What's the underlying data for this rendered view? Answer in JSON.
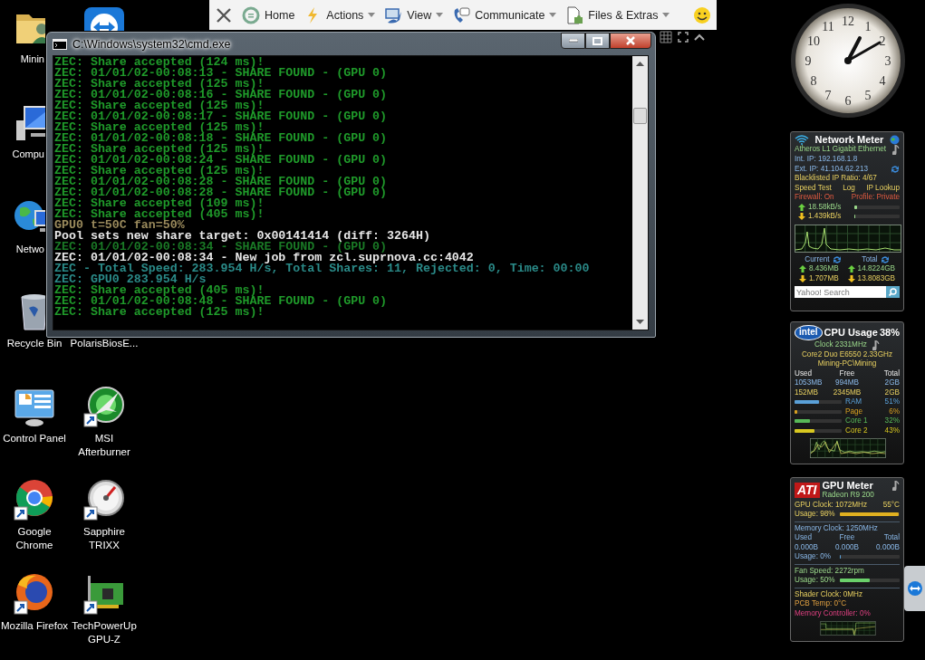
{
  "remote_toolbar": {
    "items": [
      {
        "label": "Home",
        "kind": "home",
        "dropdown": false
      },
      {
        "label": "Actions",
        "kind": "actions",
        "dropdown": true
      },
      {
        "label": "View",
        "kind": "view",
        "dropdown": true
      },
      {
        "label": "Communicate",
        "kind": "communicate",
        "dropdown": true
      },
      {
        "label": "Files & Extras",
        "kind": "files",
        "dropdown": true
      }
    ]
  },
  "desktop_icons": [
    {
      "label": "Minin",
      "kind": "folder",
      "shortcut": false
    },
    {
      "kind": "teamviewer"
    },
    {
      "label": "Compu",
      "kind": "computer",
      "shortcut": false
    },
    {
      "label": "Netwo",
      "kind": "network",
      "shortcut": false
    },
    {
      "label": "Recycle Bin",
      "kind": "recycle",
      "shortcut": false
    },
    {
      "label": "PolarisBiosE...",
      "kind": "hidden"
    },
    {
      "label": "Control Panel",
      "kind": "control-panel",
      "shortcut": false
    },
    {
      "label": "MSI Afterburner",
      "kind": "afterburner",
      "shortcut": true
    },
    {
      "label": "Google Chrome",
      "kind": "chrome",
      "shortcut": true
    },
    {
      "label": "Sapphire TRIXX",
      "kind": "gauge",
      "shortcut": true
    },
    {
      "label": "Mozilla Firefox",
      "kind": "firefox",
      "shortcut": true
    },
    {
      "label": "TechPowerUp GPU-Z",
      "kind": "card",
      "shortcut": true
    }
  ],
  "console_window": {
    "title": "C:\\Windows\\system32\\cmd.exe",
    "lines": [
      {
        "text": "ZEC: Share accepted (124 ms)!",
        "color": "#1f9a2a"
      },
      {
        "text": "ZEC: 01/01/02-00:08:13 - SHARE FOUND - (GPU 0)",
        "color": "#1f9a2a"
      },
      {
        "text": "ZEC: Share accepted (125 ms)!",
        "color": "#1f9a2a"
      },
      {
        "text": "ZEC: 01/01/02-00:08:16 - SHARE FOUND - (GPU 0)",
        "color": "#1f9a2a"
      },
      {
        "text": "ZEC: Share accepted (125 ms)!",
        "color": "#1f9a2a"
      },
      {
        "text": "ZEC: 01/01/02-00:08:17 - SHARE FOUND - (GPU 0)",
        "color": "#1f9a2a"
      },
      {
        "text": "ZEC: Share accepted (125 ms)!",
        "color": "#1f9a2a"
      },
      {
        "text": "ZEC: 01/01/02-00:08:18 - SHARE FOUND - (GPU 0)",
        "color": "#1f9a2a"
      },
      {
        "text": "ZEC: Share accepted (125 ms)!",
        "color": "#1f9a2a"
      },
      {
        "text": "ZEC: 01/01/02-00:08:24 - SHARE FOUND - (GPU 0)",
        "color": "#1f9a2a"
      },
      {
        "text": "ZEC: Share accepted (125 ms)!",
        "color": "#1f9a2a"
      },
      {
        "text": "ZEC: 01/01/02-00:08:28 - SHARE FOUND - (GPU 0)",
        "color": "#1f9a2a"
      },
      {
        "text": "ZEC: 01/01/02-00:08:28 - SHARE FOUND - (GPU 0)",
        "color": "#1f9a2a"
      },
      {
        "text": "ZEC: Share accepted (109 ms)!",
        "color": "#1f9a2a"
      },
      {
        "text": "ZEC: Share accepted (405 ms)!",
        "color": "#1f9a2a"
      },
      {
        "text": "GPU0 t=50C fan=50%",
        "color": "#9a8a5c"
      },
      {
        "text": "Pool sets new share target: 0x00141414 (diff: 3264H)",
        "color": "#e8e8e8"
      },
      {
        "text": "ZEC: 01/01/02-00:08:34 - SHARE FOUND - (GPU 0)",
        "color": "#1a7a26"
      },
      {
        "text": "ZEC: 01/01/02-00:08:34 - New job from zcl.suprnova.cc:4042",
        "color": "#e8e8e8"
      },
      {
        "text": "ZEC - Total Speed: 283.954 H/s, Total Shares: 11, Rejected: 0, Time: 00:00",
        "color": "#2a8a88"
      },
      {
        "text": "ZEC: GPU0 283.954 H/s",
        "color": "#2a8a88"
      },
      {
        "text": "ZEC: Share accepted (405 ms)!",
        "color": "#1f9a2a"
      },
      {
        "text": "ZEC: 01/01/02-00:08:48 - SHARE FOUND - (GPU 0)",
        "color": "#1f9a2a"
      },
      {
        "text": "ZEC: Share accepted (125 ms)!",
        "color": "#1f9a2a"
      }
    ]
  },
  "clock": {
    "numerals": [
      "12",
      "1",
      "2",
      "3",
      "4",
      "5",
      "6",
      "7",
      "8",
      "9",
      "10",
      "11"
    ]
  },
  "network_meter": {
    "title": "Network Meter",
    "adapter": "Atheros L1 Gigabit Ethernet",
    "int_ip": "Int. IP: 192.168.1.8",
    "ext_ip": "Ext. IP: 41.104.62.213",
    "blacklist": "Blacklisted IP Ratio: 4/67",
    "links": [
      "Speed Test",
      "Log",
      "IP Lookup"
    ],
    "firewall": "Firewall: On",
    "profile": "Profile: Private",
    "upload": {
      "rate": "18.58kB/s",
      "level": 0.05
    },
    "download": {
      "rate": "1.439kB/s",
      "level": 0.01
    },
    "current_label": "Current",
    "total_label": "Total",
    "current_up": "8.436MB",
    "current_down": "1.707MB",
    "total_up": "14.8224GB",
    "total_down": "13.8083GB",
    "search": {
      "placeholder": "Yahoo! Search"
    }
  },
  "cpu_meter": {
    "logo": "intel",
    "title": "CPU Usage",
    "usage": "38%",
    "clock": "Clock 2331MHz",
    "processor": "Core2 Duo E6550 2.33GHz",
    "machine": "Mining-PC\\Mining",
    "memory_columns": [
      "Used",
      "Free",
      "Total"
    ],
    "memory_rows": [
      [
        "1053MB",
        "994MB",
        "2GB"
      ],
      [
        "152MB",
        "2345MB",
        "2GB"
      ]
    ],
    "bars": [
      {
        "label": "RAM",
        "value": "51%",
        "level": 0.51,
        "color": "#5aa0d8"
      },
      {
        "label": "Page",
        "value": "6%",
        "level": 0.06,
        "color": "#d8a020"
      },
      {
        "label": "Core 1",
        "value": "32%",
        "level": 0.32,
        "color": "#58b858"
      },
      {
        "label": "Core 2",
        "value": "43%",
        "level": 0.43,
        "color": "#d8c820"
      }
    ]
  },
  "gpu_meter": {
    "logo": "ATI",
    "title": "GPU Meter",
    "model": "Radeon R9 200",
    "gpu_clock": "GPU Clock: 1072MHz",
    "temperature": "55°C",
    "gpu_usage": {
      "label": "Usage: 98%",
      "level": 0.98
    },
    "memory_clock": "Memory Clock: 1250MHz",
    "memory_columns": [
      "Used",
      "Free",
      "Total"
    ],
    "memory_values": [
      "0.000B",
      "0.000B",
      "0.000B"
    ],
    "memory_usage": {
      "label": "Usage: 0%",
      "level": 0
    },
    "fan_speed": "Fan Speed: 2272rpm",
    "fan_usage": {
      "label": "Usage: 50%",
      "level": 0.5
    },
    "shader_clock": "Shader Clock: 0MHz",
    "pcb_temp": "PCB Temp: 0°C",
    "memory_controller": "Memory Controller: 0%"
  }
}
